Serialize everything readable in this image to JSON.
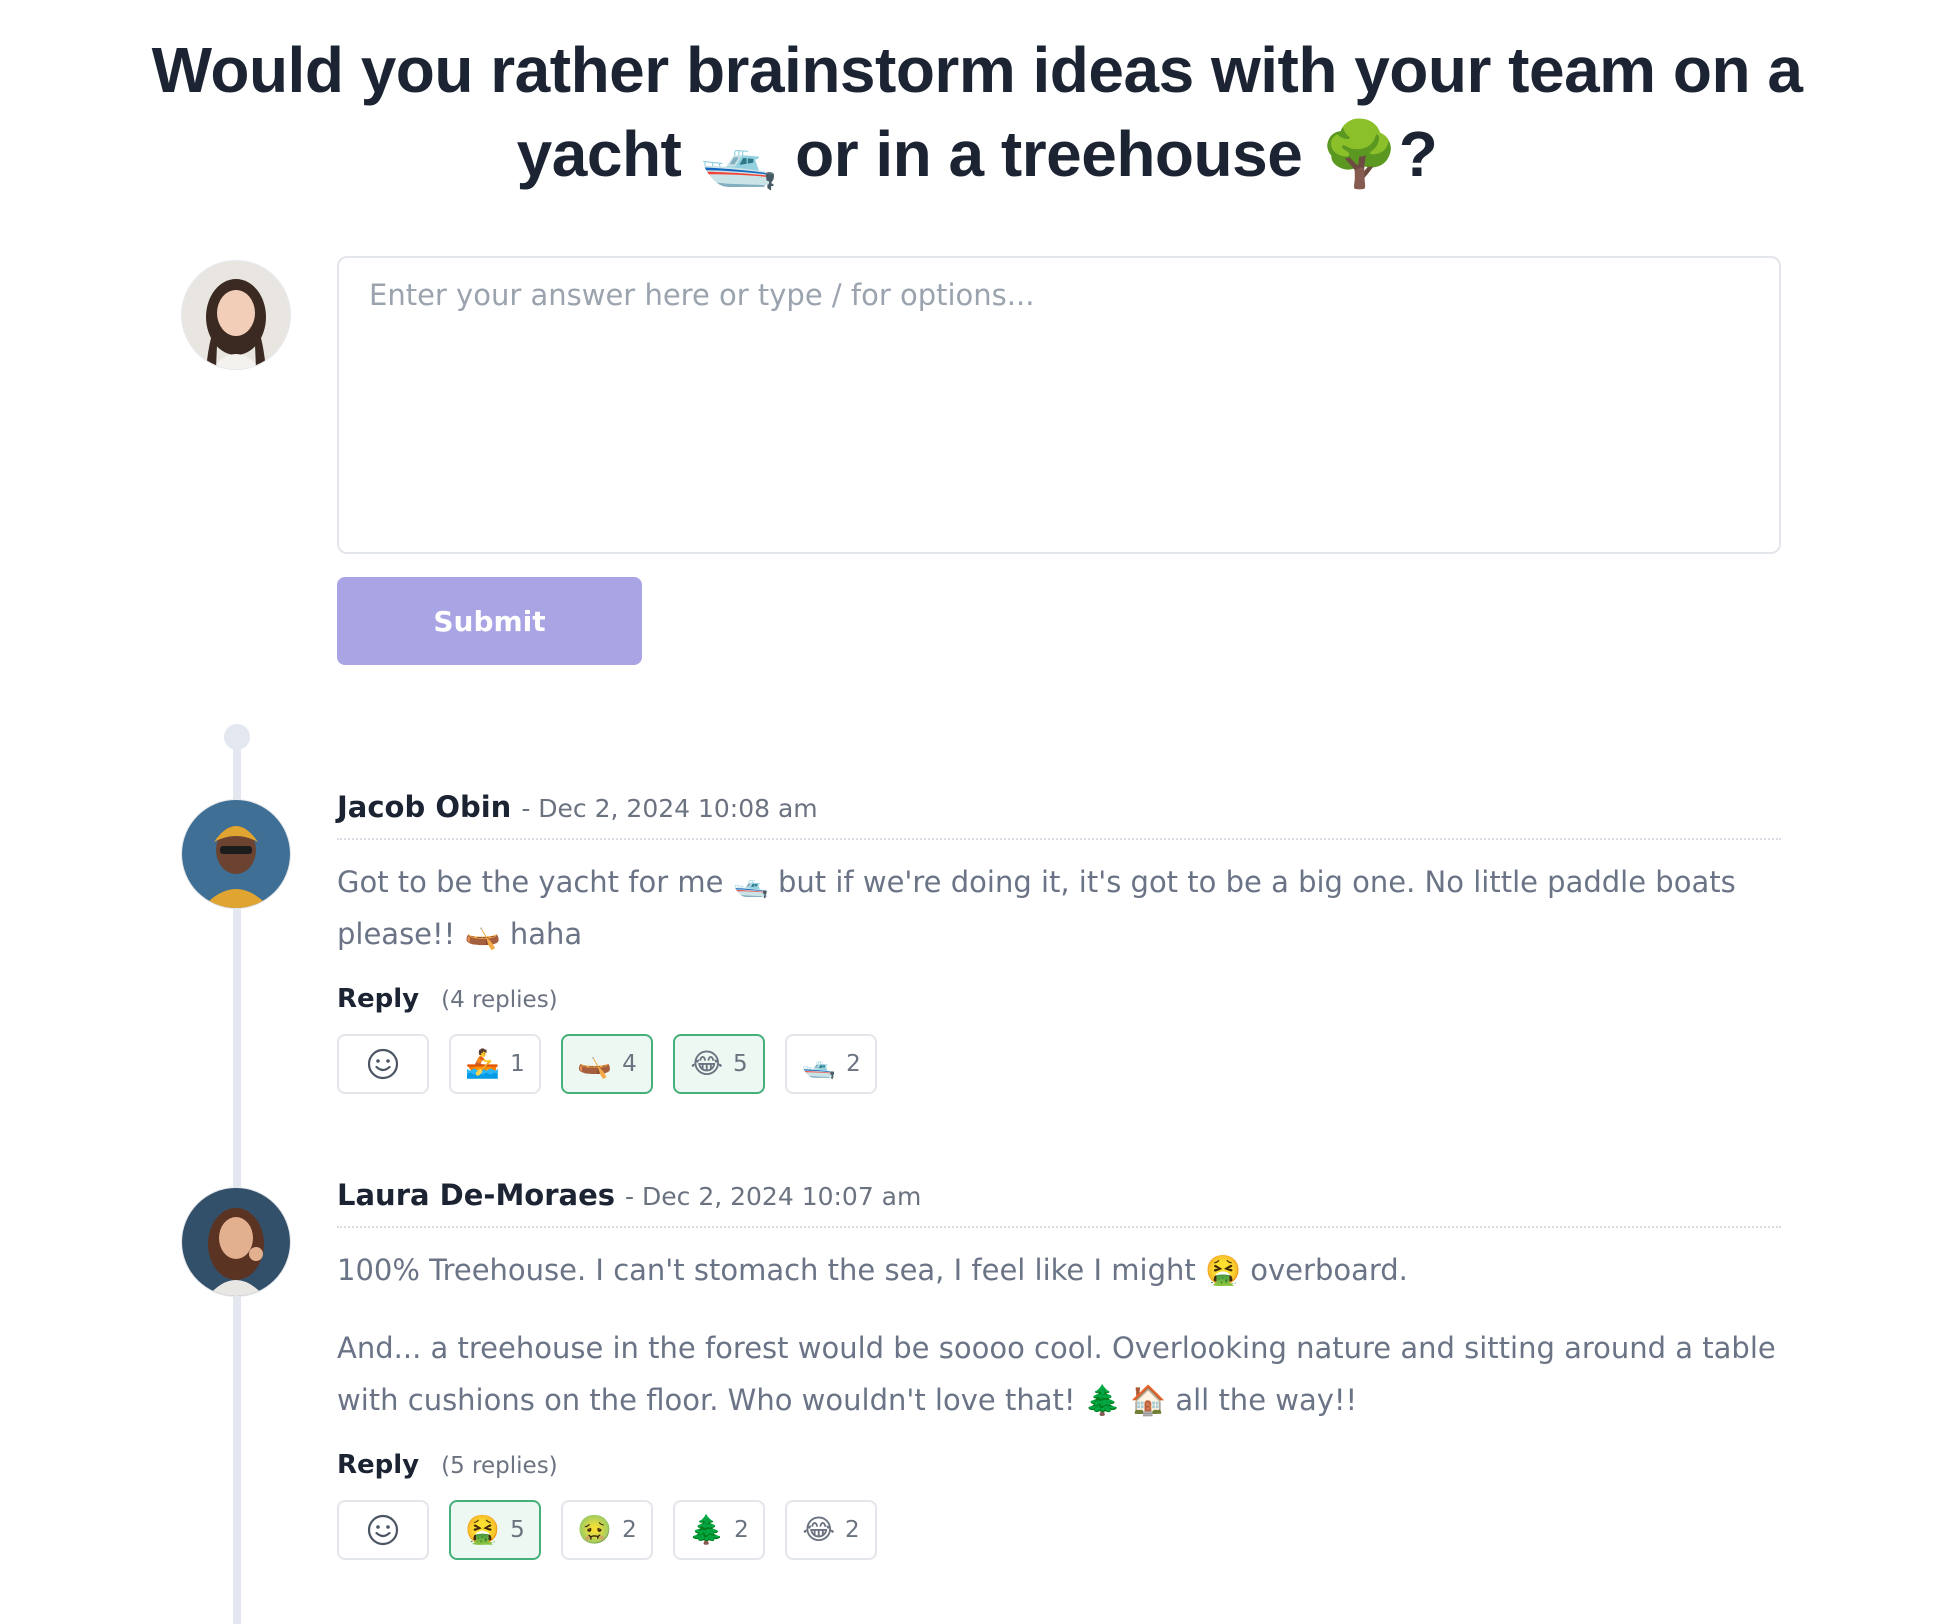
{
  "question": {
    "title": "Would you rather brainstorm ideas with your team on a yacht 🛥️ or in a treehouse 🌳?"
  },
  "composer": {
    "placeholder": "Enter your answer here or type / for options...",
    "submit_label": "Submit"
  },
  "comments": [
    {
      "author": "Jacob Obin",
      "timestamp": "- Dec 2, 2024 10:08 am",
      "paragraphs": [
        "Got to be the yacht for me 🛥️ but if we're doing it, it's got to be a big one. No little paddle boats please!! 🛶 haha"
      ],
      "reply_label": "Reply",
      "replies_text": "(4 replies)",
      "reactions": [
        {
          "emoji": "🚣",
          "count": "1",
          "active": false
        },
        {
          "emoji": "🛶",
          "count": "4",
          "active": true
        },
        {
          "emoji": "😂",
          "count": "5",
          "active": true
        },
        {
          "emoji": "🛥️",
          "count": "2",
          "active": false
        }
      ]
    },
    {
      "author": "Laura De-Moraes",
      "timestamp": "- Dec 2, 2024 10:07 am",
      "paragraphs": [
        "100% Treehouse. I can't stomach the sea, I feel like I might 🤮 overboard.",
        "And... a treehouse in the forest would be soooo cool. Overlooking nature and sitting around a table with cushions on the floor. Who wouldn't love that! 🌲 🏠 all the way!!"
      ],
      "reply_label": "Reply",
      "replies_text": "(5 replies)",
      "reactions": [
        {
          "emoji": "🤮",
          "count": "5",
          "active": true
        },
        {
          "emoji": "🤢",
          "count": "2",
          "active": false
        },
        {
          "emoji": "🌲",
          "count": "2",
          "active": false
        },
        {
          "emoji": "😂",
          "count": "2",
          "active": false
        }
      ]
    }
  ],
  "colors": {
    "title": "#1c2433",
    "submit_bg": "#a9a4e4",
    "active_reaction_border": "#45b07a",
    "timeline": "#e3e7ef"
  }
}
